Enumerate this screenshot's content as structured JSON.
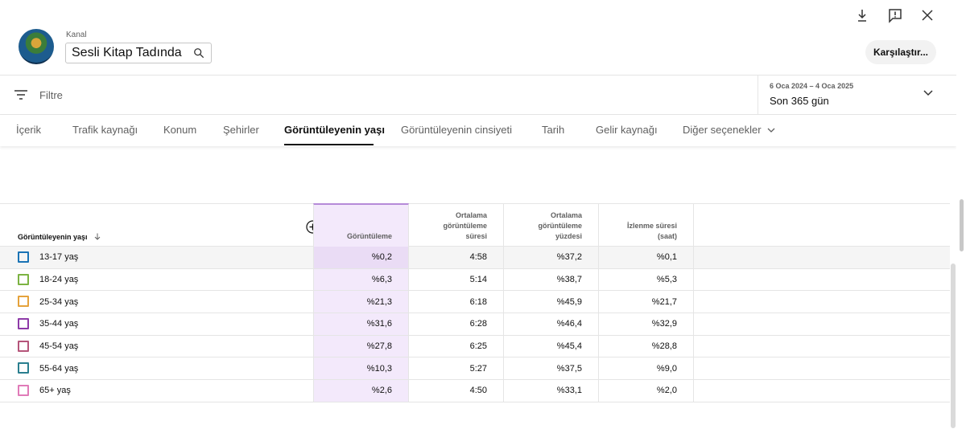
{
  "header": {
    "channel_label": "Kanal",
    "channel_name": "Sesli Kitap Tadında",
    "compare_label": "Karşılaştır..."
  },
  "filter": {
    "label": "Filtre",
    "date_range": "6 Oca 2024 – 4 Oca 2025",
    "period": "Son 365 gün"
  },
  "tabs": [
    {
      "label": "İçerik"
    },
    {
      "label": "Trafik kaynağı"
    },
    {
      "label": "Konum"
    },
    {
      "label": "Şehirler"
    },
    {
      "label": "Görüntüleyenin yaşı"
    },
    {
      "label": "Görüntüleyenin cinsiyeti"
    },
    {
      "label": "Tarih"
    },
    {
      "label": "Gelir kaynağı"
    },
    {
      "label": "Diğer seçenekler"
    }
  ],
  "table": {
    "headers": {
      "age": "Görüntüleyenin yaşı",
      "views": "Görüntüleme",
      "avg_duration_1": "Ortalama",
      "avg_duration_2": "görüntüleme",
      "avg_duration_3": "süresi",
      "avg_pct_1": "Ortalama",
      "avg_pct_2": "görüntüleme",
      "avg_pct_3": "yüzdesi",
      "watch_1": "İzlenme süresi",
      "watch_2": "(saat)"
    },
    "rows": [
      {
        "age": "13-17 yaş",
        "color": "#1a73b5",
        "views": "%0,2",
        "avg": "4:58",
        "pct": "%37,2",
        "watch": "%0,1"
      },
      {
        "age": "18-24 yaş",
        "color": "#7cb342",
        "views": "%6,3",
        "avg": "5:14",
        "pct": "%38,7",
        "watch": "%5,3"
      },
      {
        "age": "25-34 yaş",
        "color": "#e5a23b",
        "views": "%21,3",
        "avg": "6:18",
        "pct": "%45,9",
        "watch": "%21,7"
      },
      {
        "age": "35-44 yaş",
        "color": "#8e3aa8",
        "views": "%31,6",
        "avg": "6:28",
        "pct": "%46,4",
        "watch": "%32,9"
      },
      {
        "age": "45-54 yaş",
        "color": "#b5557a",
        "views": "%27,8",
        "avg": "6:25",
        "pct": "%45,4",
        "watch": "%28,8"
      },
      {
        "age": "55-64 yaş",
        "color": "#2a7f8f",
        "views": "%10,3",
        "avg": "5:27",
        "pct": "%37,5",
        "watch": "%9,0"
      },
      {
        "age": "65+ yaş",
        "color": "#e07bb8",
        "views": "%2,6",
        "avg": "4:50",
        "pct": "%33,1",
        "watch": "%2,0"
      }
    ]
  },
  "icons": {
    "download": "download-icon",
    "feedback": "feedback-icon",
    "close": "close-icon",
    "search": "search-icon",
    "filter": "filter-icon",
    "chevron": "chevron-down-icon",
    "add_metric": "add-circle-icon",
    "sort": "arrow-down-icon"
  }
}
